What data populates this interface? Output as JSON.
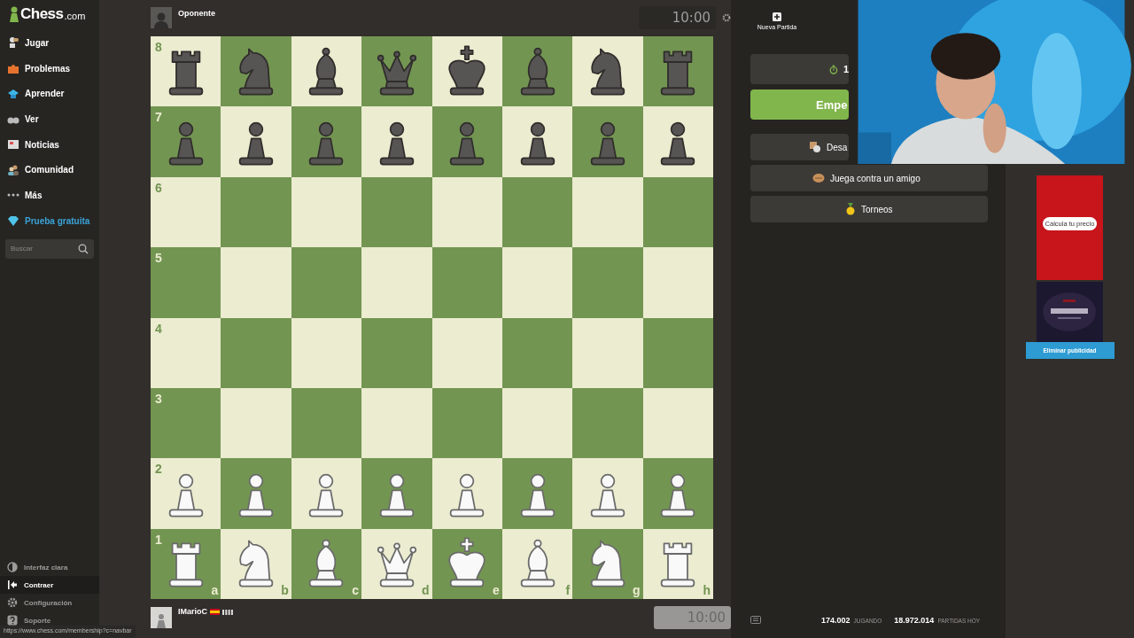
{
  "sidebar": {
    "logo": {
      "main": "Chess",
      "suffix": ".com"
    },
    "items": [
      {
        "label": "Jugar",
        "kind": "nav"
      },
      {
        "label": "Problemas",
        "kind": "nav"
      },
      {
        "label": "Aprender",
        "kind": "nav"
      },
      {
        "label": "Ver",
        "kind": "nav"
      },
      {
        "label": "Noticias",
        "kind": "nav"
      },
      {
        "label": "Comunidad",
        "kind": "nav"
      },
      {
        "label": "Más",
        "kind": "nav"
      },
      {
        "label": "Prueba gratuita",
        "kind": "promo"
      }
    ],
    "search": {
      "placeholder": "Buscar"
    },
    "footer_items": [
      {
        "label": "Interfaz clara",
        "hovered": false
      },
      {
        "label": "Contraer",
        "hovered": true
      },
      {
        "label": "Configuración",
        "hovered": false
      },
      {
        "label": "Soporte",
        "hovered": false
      }
    ]
  },
  "opponent": {
    "name": "Oponente",
    "clock": "10:00",
    "clock_active": false
  },
  "board": {
    "files": [
      "a",
      "b",
      "c",
      "d",
      "e",
      "f",
      "g",
      "h"
    ],
    "ranks": [
      {
        "label": "8",
        "squares": [
          {
            "kind": "rook",
            "white": false
          },
          {
            "kind": "knight",
            "white": false
          },
          {
            "kind": "bishop",
            "white": false
          },
          {
            "kind": "queen",
            "white": false
          },
          {
            "kind": "king",
            "white": false
          },
          {
            "kind": "bishop",
            "white": false
          },
          {
            "kind": "knight",
            "white": false
          },
          {
            "kind": "rook",
            "white": false
          }
        ]
      },
      {
        "label": "7",
        "squares": [
          {
            "kind": "pawn",
            "white": false
          },
          {
            "kind": "pawn",
            "white": false
          },
          {
            "kind": "pawn",
            "white": false
          },
          {
            "kind": "pawn",
            "white": false
          },
          {
            "kind": "pawn",
            "white": false
          },
          {
            "kind": "pawn",
            "white": false
          },
          {
            "kind": "pawn",
            "white": false
          },
          {
            "kind": "pawn",
            "white": false
          }
        ]
      },
      {
        "label": "6",
        "squares": [
          {
            "kind": "empty"
          },
          {
            "kind": "empty"
          },
          {
            "kind": "empty"
          },
          {
            "kind": "empty"
          },
          {
            "kind": "empty"
          },
          {
            "kind": "empty"
          },
          {
            "kind": "empty"
          },
          {
            "kind": "empty"
          }
        ]
      },
      {
        "label": "5",
        "squares": [
          {
            "kind": "empty"
          },
          {
            "kind": "empty"
          },
          {
            "kind": "empty"
          },
          {
            "kind": "empty"
          },
          {
            "kind": "empty"
          },
          {
            "kind": "empty"
          },
          {
            "kind": "empty"
          },
          {
            "kind": "empty"
          }
        ]
      },
      {
        "label": "4",
        "squares": [
          {
            "kind": "empty"
          },
          {
            "kind": "empty"
          },
          {
            "kind": "empty"
          },
          {
            "kind": "empty"
          },
          {
            "kind": "empty"
          },
          {
            "kind": "empty"
          },
          {
            "kind": "empty"
          },
          {
            "kind": "empty"
          }
        ]
      },
      {
        "label": "3",
        "squares": [
          {
            "kind": "empty"
          },
          {
            "kind": "empty"
          },
          {
            "kind": "empty"
          },
          {
            "kind": "empty"
          },
          {
            "kind": "empty"
          },
          {
            "kind": "empty"
          },
          {
            "kind": "empty"
          },
          {
            "kind": "empty"
          }
        ]
      },
      {
        "label": "2",
        "squares": [
          {
            "kind": "pawn",
            "white": true
          },
          {
            "kind": "pawn",
            "white": true
          },
          {
            "kind": "pawn",
            "white": true
          },
          {
            "kind": "pawn",
            "white": true
          },
          {
            "kind": "pawn",
            "white": true
          },
          {
            "kind": "pawn",
            "white": true
          },
          {
            "kind": "pawn",
            "white": true
          },
          {
            "kind": "pawn",
            "white": true
          }
        ]
      },
      {
        "label": "1",
        "squares": [
          {
            "kind": "rook",
            "white": true
          },
          {
            "kind": "knight",
            "white": true
          },
          {
            "kind": "bishop",
            "white": true
          },
          {
            "kind": "queen",
            "white": true
          },
          {
            "kind": "king",
            "white": true
          },
          {
            "kind": "bishop",
            "white": true
          },
          {
            "kind": "knight",
            "white": true
          },
          {
            "kind": "rook",
            "white": true
          }
        ]
      }
    ]
  },
  "player": {
    "name": "IMarioC",
    "clock": "10:00",
    "clock_active": true
  },
  "new_game_tab": {
    "label": "Nueva Partida"
  },
  "actions": [
    {
      "label": "1",
      "kind": "time"
    },
    {
      "label": "Empe",
      "kind": "primary"
    },
    {
      "label": "Desa",
      "kind": "challenge"
    },
    {
      "label": "Juega contra un amigo",
      "kind": "friend"
    },
    {
      "label": "Torneos",
      "kind": "tournament"
    }
  ],
  "stats": [
    {
      "value": "174.002",
      "label": "JUGANDO"
    },
    {
      "value": "18.972.014",
      "label": "PARTIDAS HOY"
    }
  ],
  "ads": {
    "cta": "Calcula tu precio",
    "remove": "Eliminar publicidad"
  },
  "status_url": "https://www.chess.com/membership?c=navbar"
}
